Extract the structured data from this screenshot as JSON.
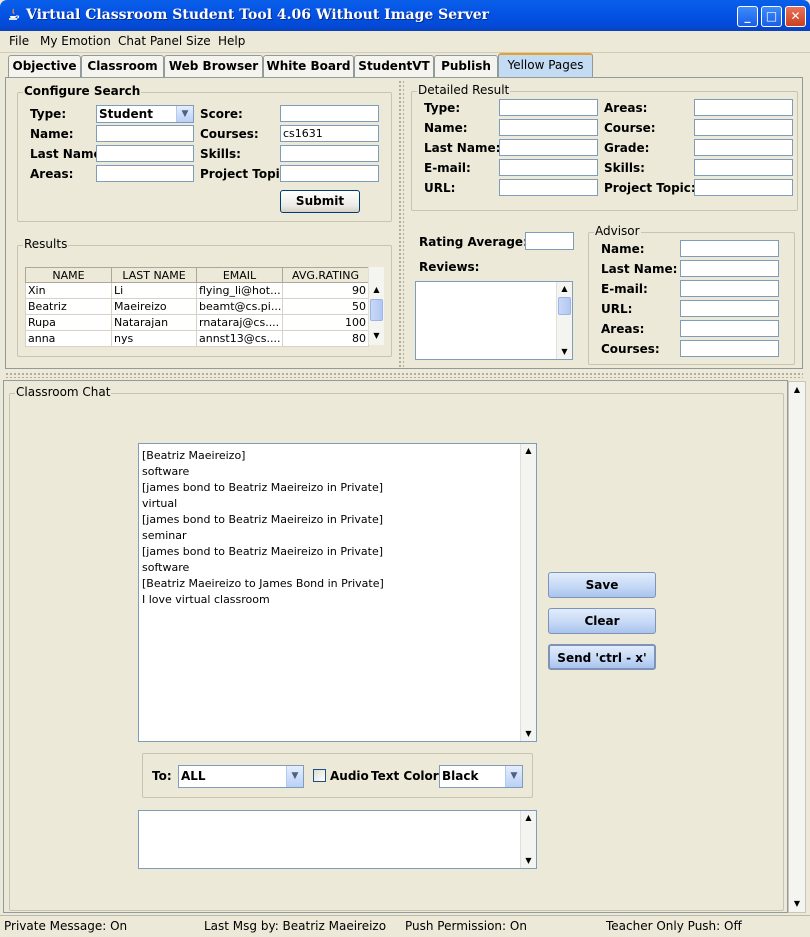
{
  "window": {
    "title": "Virtual Classroom Student Tool 4.06 Without Image Server"
  },
  "menu": [
    "File",
    "My Emotion",
    "Chat Panel Size",
    "Help"
  ],
  "tabs": [
    "Objective",
    "Classroom",
    "Web Browser",
    "White Board",
    "StudentVT",
    "Publish",
    "Yellow Pages"
  ],
  "configure_search": {
    "title": "Configure Search",
    "type_label": "Type:",
    "type_value": "Student",
    "score_label": "Score:",
    "score_value": "",
    "name_label": "Name:",
    "name_value": "",
    "courses_label": "Courses:",
    "courses_value": "cs1631",
    "lastname_label": "Last Name:",
    "lastname_value": "",
    "skills_label": "Skills:",
    "skills_value": "",
    "areas_label": "Areas:",
    "areas_value": "",
    "project_label": "Project Topic:",
    "project_value": "",
    "submit_label": "Submit"
  },
  "results": {
    "title": "Results",
    "columns": [
      "NAME",
      "LAST NAME",
      "EMAIL",
      "AVG.RATING"
    ],
    "rows": [
      [
        "Xin",
        "Li",
        "flying_li@hot...",
        "90"
      ],
      [
        "Beatriz",
        "Maeireizo",
        "beamt@cs.pi...",
        "50"
      ],
      [
        "Rupa",
        "Natarajan",
        "rnataraj@cs....",
        "100"
      ],
      [
        "anna",
        "nys",
        "annst13@cs....",
        "80"
      ]
    ]
  },
  "detailed": {
    "title": "Detailed Result",
    "type_label": "Type:",
    "areas_label": "Areas:",
    "name_label": "Name:",
    "course_label": "Course:",
    "lastname_label": "Last Name:",
    "grade_label": "Grade:",
    "email_label": "E-mail:",
    "skills_label": "Skills:",
    "url_label": "URL:",
    "project_label": "Project Topic:",
    "rating_label": "Rating Average:",
    "reviews_label": "Reviews:"
  },
  "advisor": {
    "title": "Advisor",
    "name_label": "Name:",
    "lastname_label": "Last Name:",
    "email_label": "E-mail:",
    "url_label": "URL:",
    "areas_label": "Areas:",
    "courses_label": "Courses:"
  },
  "chat": {
    "title": "Classroom Chat",
    "messages": [
      "[Beatriz Maeireizo]",
      "software",
      "[james bond to Beatriz Maeireizo in Private]",
      "virtual",
      "[james bond to Beatriz Maeireizo in Private]",
      "seminar",
      "[james bond to Beatriz Maeireizo in Private]",
      "software",
      "[Beatriz Maeireizo to James Bond in Private]",
      "I love virtual classroom"
    ],
    "save_label": "Save",
    "clear_label": "Clear",
    "send_label": "Send 'ctrl - x'",
    "to_label": "To:",
    "to_value": "ALL",
    "audio_label": "Audio",
    "color_label": "Text Color:",
    "color_value": "Black",
    "input_value": ""
  },
  "status": {
    "private": "Private Message: On",
    "lastmsg": "Last Msg by: Beatriz Maeireizo",
    "push": "Push Permission: On",
    "teacher": "Teacher Only Push: Off"
  }
}
